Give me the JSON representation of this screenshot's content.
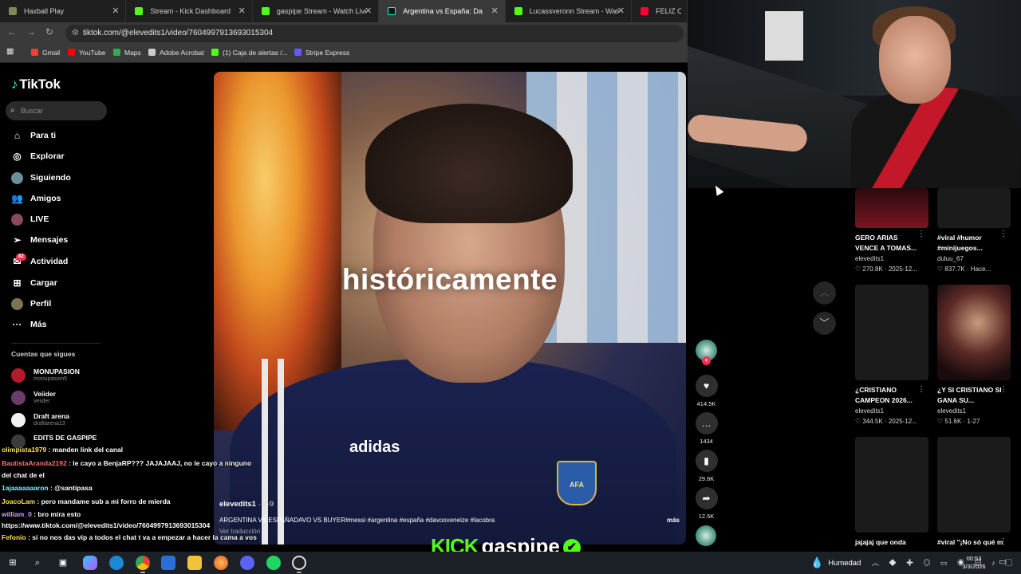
{
  "browser": {
    "tabs": [
      {
        "title": "Haxball Play",
        "color": "#7c8a5a",
        "active": false
      },
      {
        "title": "Stream - Kick Dashboard",
        "color": "#53fc18",
        "active": false
      },
      {
        "title": "gaspipe Stream - Watch Live o",
        "color": "#53fc18",
        "active": false
      },
      {
        "title": "Argentina vs España: Davo",
        "color": "#ffffff",
        "active": true
      },
      {
        "title": "Lucassveronn Stream - Watch L",
        "color": "#53fc18",
        "active": false
      },
      {
        "title": "FELIZ C",
        "color": "#ff0033",
        "active": false
      }
    ],
    "url": "tiktok.com/@elevedits1/video/7604997913693015304",
    "bookmarks": [
      {
        "label": "Gmail",
        "color": "#ea4335"
      },
      {
        "label": "YouTube",
        "color": "#ff0000"
      },
      {
        "label": "Maps",
        "color": "#34a853"
      },
      {
        "label": "Adobe Acrobat",
        "color": "#cccccc"
      },
      {
        "label": "(1) Caja de alertas /...",
        "color": "#53fc18"
      },
      {
        "label": "Stripe Express",
        "color": "#635bff"
      }
    ]
  },
  "tiktok": {
    "logo": "TikTok",
    "search_placeholder": "Buscar",
    "nav": [
      {
        "label": "Para ti",
        "icon": "home-icon"
      },
      {
        "label": "Explorar",
        "icon": "compass-icon"
      },
      {
        "label": "Siguiendo",
        "icon": "following-icon"
      },
      {
        "label": "Amigos",
        "icon": "friends-icon"
      },
      {
        "label": "LIVE",
        "icon": "live-icon"
      },
      {
        "label": "Mensajes",
        "icon": "send-icon"
      },
      {
        "label": "Actividad",
        "icon": "activity-icon",
        "badge": "82"
      },
      {
        "label": "Cargar",
        "icon": "upload-icon"
      },
      {
        "label": "Perfil",
        "icon": "profile-icon"
      },
      {
        "label": "Más",
        "icon": "more-icon"
      }
    ],
    "following_title": "Cuentas que sigues",
    "following": [
      {
        "name": "MONUPASION",
        "handle": "monupasion5"
      },
      {
        "name": "Veiider",
        "handle": "veiider"
      },
      {
        "name": "Draft arena",
        "handle": "draftarena13"
      },
      {
        "name": "EDITS DE GASPIPE",
        "handle": ""
      }
    ],
    "video": {
      "caption_overlay": "históricamente",
      "shirt_brand": "adidas",
      "crest": "AFA",
      "author": "elevedits1",
      "date": "· 2-9",
      "description": "ARGENTINA VS ESPAÑADAVO VS BUYER#messi #argentina #españa #davooxeneize #lacobra",
      "more": "más",
      "translate": "Ver traducción"
    },
    "actions": {
      "likes": "414.5K",
      "comments": "1434",
      "saves": "29.6K",
      "shares": "12.5K"
    },
    "recommendations": [
      {
        "title": "GERO ARIAS VENCE A TOMAS...",
        "user": "elevedits1",
        "meta": "♡ 270.8K · 2025-12..."
      },
      {
        "title": "#viral #humor #minijuegos...",
        "user": "duluu_67",
        "meta": "♡ 837.7K · Hace..."
      },
      {
        "title": "¿CRISTIANO CAMPEON 2026...",
        "user": "elevedits1",
        "meta": "♡ 344.5K · 2025-12..."
      },
      {
        "title": "¿Y SI CRISTIANO SI GANA SU...",
        "user": "elevedits1",
        "meta": "♡ 51.6K · 1-27"
      },
      {
        "title": "jajajaj que onda",
        "user": "",
        "meta": ""
      },
      {
        "title": "#viral \"¡No só qué más hacer!\"...",
        "user": "",
        "meta": ""
      }
    ]
  },
  "chat": [
    {
      "user": "olimpista1979",
      "text": ": manden link del canal"
    },
    {
      "user": "BautistaAranda2192",
      "text": ": le cayo a BenjaRP??? JAJAJAAJ, no le cayo a ninguno"
    },
    {
      "user": "",
      "text": "del chat de el"
    },
    {
      "user": "1ajaaaaaaaron",
      "text": ": @santipasa"
    },
    {
      "user": "JoacoLam",
      "text": ": pero mandame sub a mi forro de mierda"
    },
    {
      "user": "william_0",
      "text": ": bro mira esto"
    },
    {
      "user": "",
      "text": "https://www.tiktok.com/@elevedits1/video/7604997913693015304"
    },
    {
      "user": "Fefonio",
      "text": ": si no nos das vip a todos el chat t va a empezar a hacer la cama a vos"
    }
  ],
  "kick": {
    "brand": "KICK",
    "channel": "gaspipe",
    "verified": "✔"
  },
  "taskbar": {
    "weather": "Humedad",
    "time": "00:53",
    "date": "3/3/2026"
  }
}
